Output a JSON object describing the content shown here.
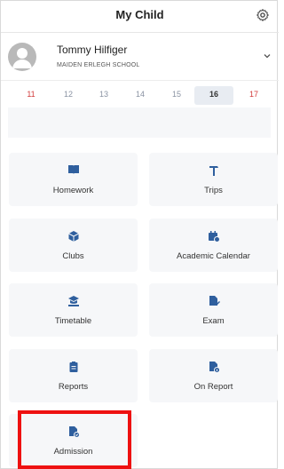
{
  "header": {
    "title": "My Child",
    "settings_icon": "gear-icon"
  },
  "profile": {
    "name": "Tommy Hilfiger",
    "school": "MAIDEN ERLEGH SCHOOL",
    "expand_icon": "chevron-down-icon"
  },
  "dates": [
    {
      "day": "11",
      "weekend": true,
      "selected": false
    },
    {
      "day": "12",
      "weekend": false,
      "selected": false
    },
    {
      "day": "13",
      "weekend": false,
      "selected": false
    },
    {
      "day": "14",
      "weekend": false,
      "selected": false
    },
    {
      "day": "15",
      "weekend": false,
      "selected": false
    },
    {
      "day": "16",
      "weekend": false,
      "selected": true
    },
    {
      "day": "17",
      "weekend": true,
      "selected": false
    }
  ],
  "tiles": [
    {
      "label": "Homework",
      "icon": "book-icon"
    },
    {
      "label": "Trips",
      "icon": "hammer-icon"
    },
    {
      "label": "Clubs",
      "icon": "cube-icon"
    },
    {
      "label": "Academic Calendar",
      "icon": "calendar-clock-icon"
    },
    {
      "label": "Timetable",
      "icon": "graduation-cap-icon"
    },
    {
      "label": "Exam",
      "icon": "document-pencil-icon"
    },
    {
      "label": "Reports",
      "icon": "clipboard-icon"
    },
    {
      "label": "On Report",
      "icon": "document-info-icon"
    },
    {
      "label": "Admission",
      "icon": "document-check-icon"
    }
  ],
  "colors": {
    "icon_blue": "#2f5f9e",
    "highlight_red": "#ee1111",
    "weekend_red": "#d23b3b",
    "tile_bg": "#f6f7f9"
  }
}
